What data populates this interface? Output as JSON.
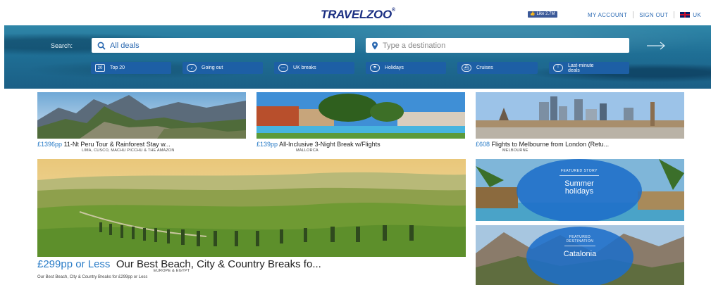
{
  "header": {
    "logo": {
      "part1": "TRAVEL",
      "part2": "ZOO"
    },
    "like_badge": "Like 2.7M",
    "links": [
      "MY ACCOUNT",
      "SIGN OUT"
    ],
    "region": "UK"
  },
  "search": {
    "label": "Search:",
    "deals_value": "All deals",
    "destination_placeholder": "Type a destination"
  },
  "categories": [
    {
      "icon": "top20-icon",
      "label": "Top 20"
    },
    {
      "icon": "going-out-icon",
      "label": "Going out"
    },
    {
      "icon": "uk-breaks-icon",
      "label": "UK breaks"
    },
    {
      "icon": "holidays-icon",
      "label": "Holidays"
    },
    {
      "icon": "cruises-icon",
      "label": "Cruises"
    },
    {
      "icon": "last-minute-icon",
      "label": "Last-minute deals"
    }
  ],
  "deals": [
    {
      "price": "£1396pp",
      "title": "11-Nt Peru Tour & Rainforest Stay w...",
      "location": "LIMA, CUSCO, MACHU PICCHU & THE AMAZON"
    },
    {
      "price": "£139pp",
      "title": "All-Inclusive 3-Night Break w/Flights",
      "location": "MALLORCA"
    },
    {
      "price": "£608",
      "title": "Flights to Melbourne from London (Retu...",
      "location": "MELBOURNE"
    }
  ],
  "hero_deal": {
    "price": "£299pp or Less",
    "title": "Our Best Beach, City & Country Breaks fo...",
    "location": "EUROPE & EGYPT",
    "description": "Our Best Beach, City & Country Breaks for £299pp or Less"
  },
  "featured": [
    {
      "kicker": "FEATURED STORY",
      "title": "Summer holidays"
    },
    {
      "kicker": "FEATURED DESTINATION",
      "title": "Catalonia"
    }
  ],
  "colors": {
    "brand_blue": "#1b2f82",
    "link_blue": "#2f6db5",
    "price_blue": "#2a7cc7",
    "category_blue": "#1d5fa5"
  }
}
